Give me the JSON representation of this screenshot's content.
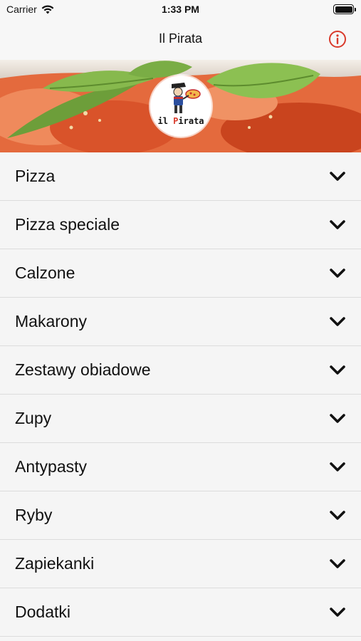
{
  "status_bar": {
    "carrier": "Carrier",
    "time": "1:33 PM"
  },
  "nav": {
    "title": "Il Pirata"
  },
  "logo": {
    "text_il": "il ",
    "text_p": "P",
    "text_rest": "irata"
  },
  "colors": {
    "accent_red": "#d93a2b",
    "row_background": "#f5f5f5",
    "divider": "#dcdcdc"
  },
  "menu": {
    "items": [
      {
        "label": "Pizza",
        "icon": "chevron-down-icon"
      },
      {
        "label": "Pizza speciale",
        "icon": "chevron-down-icon"
      },
      {
        "label": "Calzone",
        "icon": "chevron-down-icon"
      },
      {
        "label": "Makarony",
        "icon": "chevron-down-icon"
      },
      {
        "label": "Zestawy obiadowe",
        "icon": "chevron-down-icon"
      },
      {
        "label": "Zupy",
        "icon": "chevron-down-icon"
      },
      {
        "label": "Antypasty",
        "icon": "chevron-down-icon"
      },
      {
        "label": "Ryby",
        "icon": "chevron-down-icon"
      },
      {
        "label": "Zapiekanki",
        "icon": "chevron-down-icon"
      },
      {
        "label": "Dodatki",
        "icon": "chevron-down-icon"
      }
    ]
  }
}
